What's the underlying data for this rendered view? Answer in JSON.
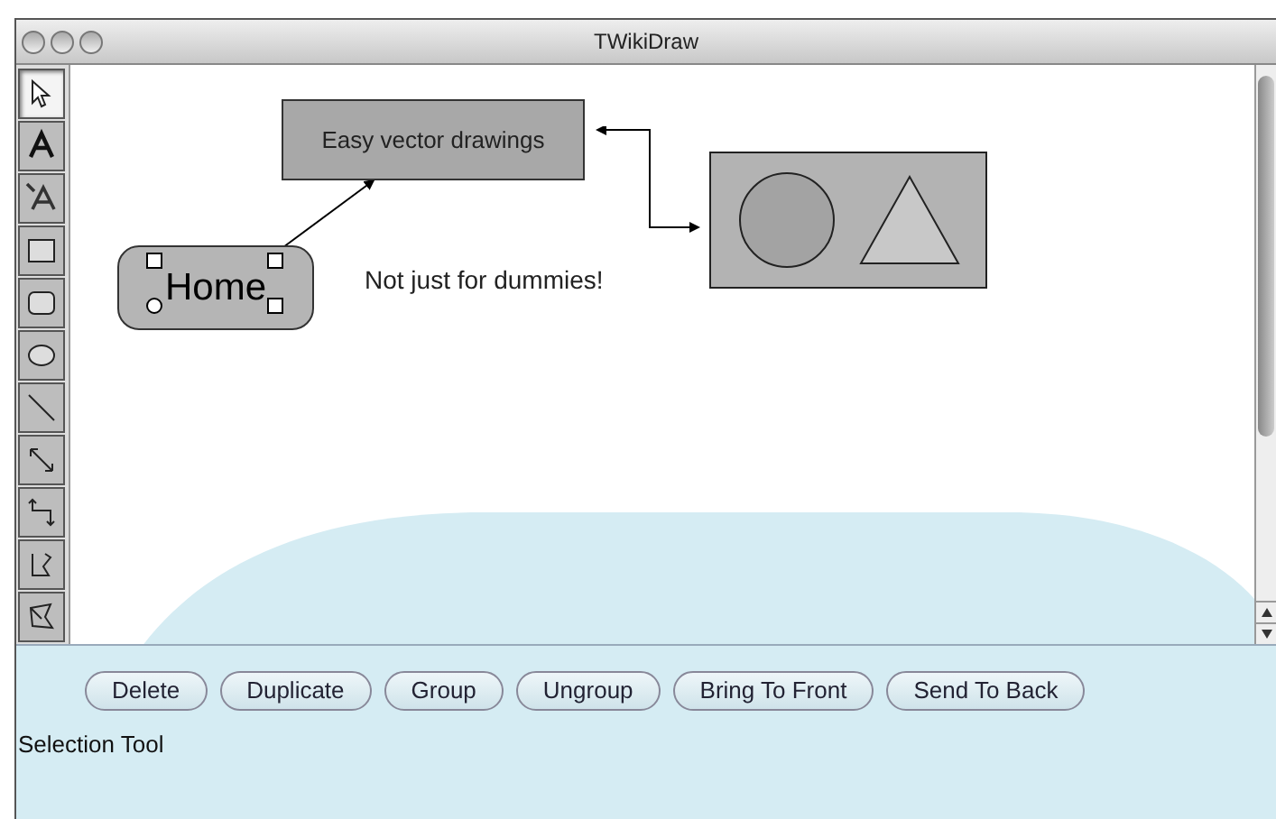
{
  "window": {
    "title": "TWikiDraw"
  },
  "tools": [
    {
      "kind": "select",
      "selected": true
    },
    {
      "kind": "text",
      "selected": false
    },
    {
      "kind": "connected-text",
      "selected": false
    },
    {
      "kind": "rectangle",
      "selected": false
    },
    {
      "kind": "round-rectangle",
      "selected": false
    },
    {
      "kind": "ellipse",
      "selected": false
    },
    {
      "kind": "line",
      "selected": false
    },
    {
      "kind": "arrow",
      "selected": false
    },
    {
      "kind": "elbow",
      "selected": false
    },
    {
      "kind": "scribble",
      "selected": false
    },
    {
      "kind": "polygon",
      "selected": false
    }
  ],
  "canvas": {
    "figures": [
      {
        "kind": "box",
        "text": "Easy vector drawings"
      },
      {
        "kind": "rounded",
        "text": "Home",
        "selected": true
      },
      {
        "kind": "label",
        "text": "Not just for dummies!"
      },
      {
        "kind": "group"
      }
    ]
  },
  "buttons": [
    "Delete",
    "Duplicate",
    "Group",
    "Ungroup",
    "Bring To Front",
    "Send To Back"
  ],
  "status_bar": "Selection Tool"
}
